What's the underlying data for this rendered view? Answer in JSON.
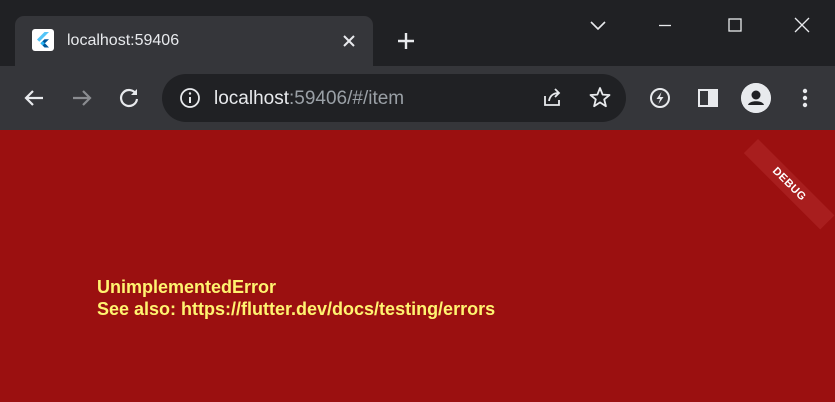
{
  "tab": {
    "title": "localhost:59406",
    "favicon": "flutter-icon"
  },
  "address_bar": {
    "host": "localhost",
    "rest": ":59406/#/item"
  },
  "content": {
    "debug_banner": "DEBUG",
    "error_title": "UnimplementedError",
    "error_detail": "See also: https://flutter.dev/docs/testing/errors"
  },
  "colors": {
    "page_background": "#9b1010",
    "error_text": "#fff370",
    "browser_frame": "#202124",
    "toolbar": "#35363a"
  }
}
